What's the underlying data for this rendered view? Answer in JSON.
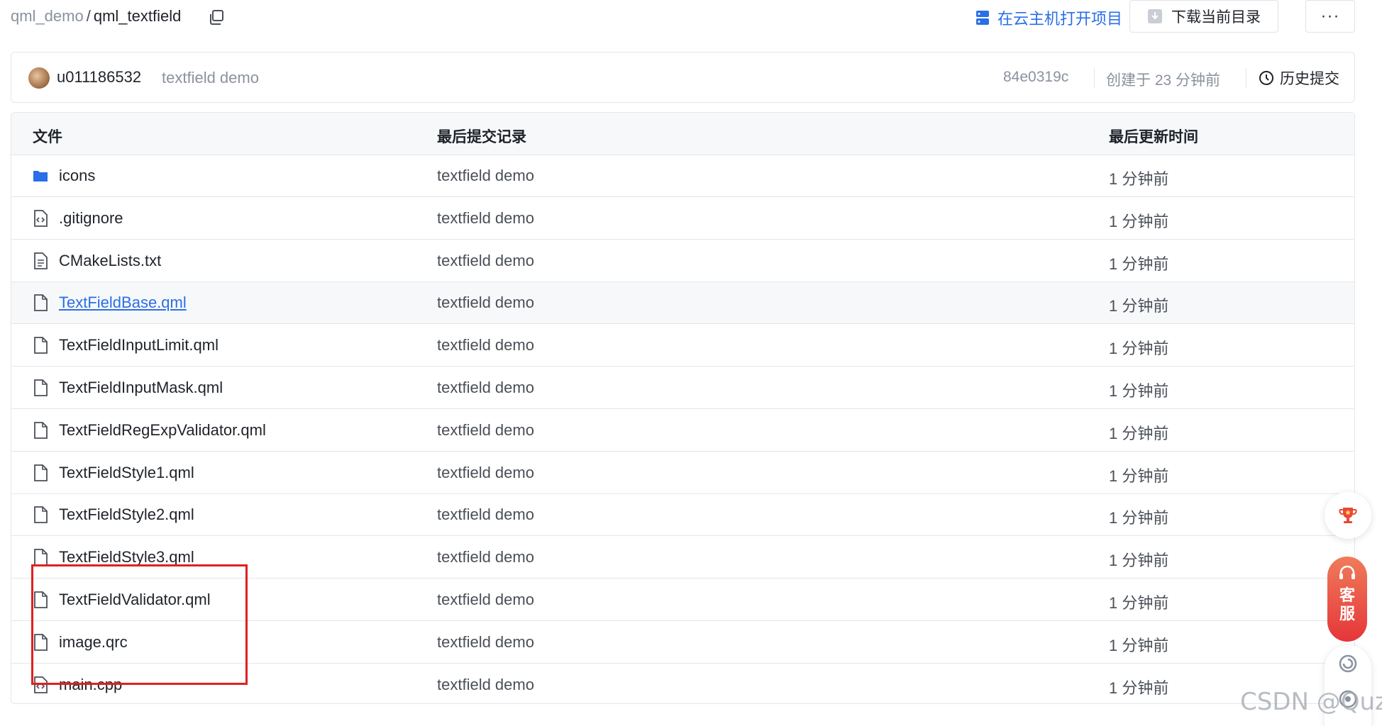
{
  "breadcrumb": {
    "parent": "qml_demo",
    "separator": "/",
    "current": "qml_textfield"
  },
  "toolbar": {
    "open_cloud_label": "在云主机打开项目",
    "download_label": "下载当前目录",
    "more_label": "···"
  },
  "commit": {
    "author": "u011186532",
    "message": "textfield demo",
    "hash": "84e0319c",
    "created": "创建于 23 分钟前",
    "history_label": "历史提交"
  },
  "table": {
    "headers": {
      "file": "文件",
      "last_commit": "最后提交记录",
      "last_updated": "最后更新时间"
    },
    "rows": [
      {
        "name": "icons",
        "type": "folder",
        "message": "textfield demo",
        "time": "1 分钟前"
      },
      {
        "name": ".gitignore",
        "type": "code",
        "message": "textfield demo",
        "time": "1 分钟前"
      },
      {
        "name": "CMakeLists.txt",
        "type": "text",
        "message": "textfield demo",
        "time": "1 分钟前"
      },
      {
        "name": "TextFieldBase.qml",
        "type": "file",
        "message": "textfield demo",
        "time": "1 分钟前"
      },
      {
        "name": "TextFieldInputLimit.qml",
        "type": "file",
        "message": "textfield demo",
        "time": "1 分钟前"
      },
      {
        "name": "TextFieldInputMask.qml",
        "type": "file",
        "message": "textfield demo",
        "time": "1 分钟前"
      },
      {
        "name": "TextFieldRegExpValidator.qml",
        "type": "file",
        "message": "textfield demo",
        "time": "1 分钟前"
      },
      {
        "name": "TextFieldStyle1.qml",
        "type": "file",
        "message": "textfield demo",
        "time": "1 分钟前"
      },
      {
        "name": "TextFieldStyle2.qml",
        "type": "file",
        "message": "textfield demo",
        "time": "1 分钟前"
      },
      {
        "name": "TextFieldStyle3.qml",
        "type": "file",
        "message": "textfield demo",
        "time": "1 分钟前"
      },
      {
        "name": "TextFieldValidator.qml",
        "type": "file",
        "message": "textfield demo",
        "time": "1 分钟前"
      },
      {
        "name": "image.qrc",
        "type": "file",
        "message": "textfield demo",
        "time": "1 分钟前"
      },
      {
        "name": "main.cpp",
        "type": "code",
        "message": "textfield demo",
        "time": "1 分钟前"
      }
    ]
  },
  "float": {
    "service_label": "客服"
  },
  "watermark": "CSDN @Quz",
  "colors": {
    "link": "#2a6ee8",
    "highlight_box": "#e02020",
    "service_gradient_top": "#f07b5a",
    "service_gradient_bottom": "#e5363a",
    "folder": "#2a6ee8"
  },
  "icons": {
    "copy": "copy-icon",
    "cloud": "cloud-server-icon",
    "download": "download-icon",
    "history": "clock-icon",
    "folder": "folder-icon",
    "code_file": "code-file-icon",
    "text_file": "text-file-icon",
    "file": "file-icon",
    "trophy": "trophy-icon",
    "headset": "headset-icon",
    "swirl": "swirl-icon",
    "help": "help-icon"
  }
}
